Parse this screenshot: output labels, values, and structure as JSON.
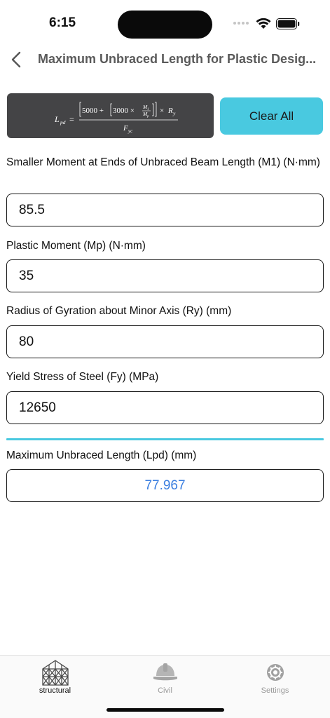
{
  "status_bar": {
    "time": "6:15"
  },
  "nav": {
    "title": "Maximum Unbraced Length for Plastic Desig..."
  },
  "formula": {
    "lhs": "L",
    "lhs_sub": "pd",
    "eq": "=",
    "n1": "5000 +",
    "n2": "3000 ×",
    "frac_num": "M",
    "frac_num_sub": "1",
    "frac_den": "M",
    "frac_den_sub": "p",
    "times": "×",
    "ry": "R",
    "ry_sub": "y",
    "denominator": "F",
    "denominator_sub": "yc"
  },
  "clear_button": {
    "label": "Clear All"
  },
  "fields": [
    {
      "label": "Smaller Moment at Ends of Unbraced Beam Length (M1) (N·mm)",
      "value": "85.5"
    },
    {
      "label": "Plastic Moment (Mp) (N·mm)",
      "value": "35"
    },
    {
      "label": "Radius of Gyration about Minor Axis (Ry) (mm)",
      "value": "80"
    },
    {
      "label": "Yield Stress of Steel (Fy) (MPa)",
      "value": "12650"
    }
  ],
  "result": {
    "label": "Maximum Unbraced Length (Lpd) (mm)",
    "value": "77.967"
  },
  "tabs": [
    {
      "label": "structural",
      "icon": "structural-icon",
      "active": true
    },
    {
      "label": "Civil",
      "icon": "helmet-icon",
      "active": false
    },
    {
      "label": "Settings",
      "icon": "gear-icon",
      "active": false
    }
  ],
  "colors": {
    "accent": "#49c9e0",
    "result_text": "#3b7fe0",
    "formula_bg": "#444446"
  }
}
